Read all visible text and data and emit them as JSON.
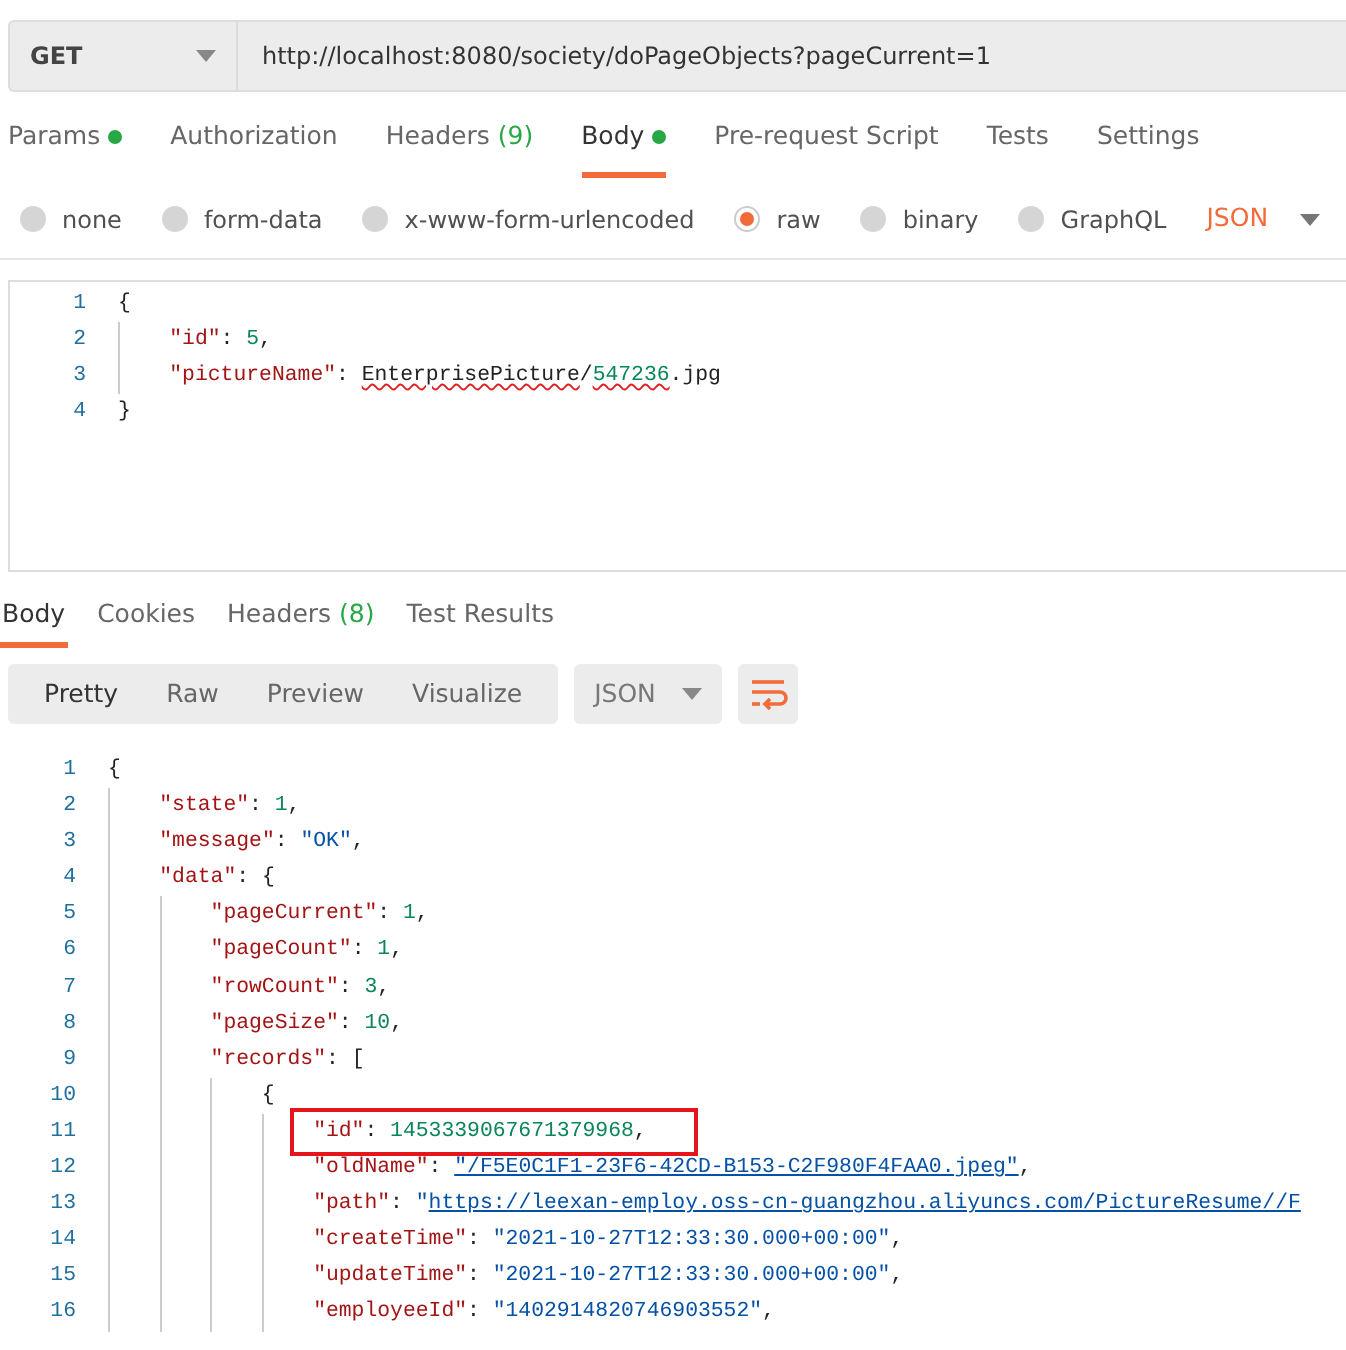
{
  "request": {
    "method": "GET",
    "url": "http://localhost:8080/society/doPageObjects?pageCurrent=1"
  },
  "request_tabs": [
    {
      "label": "Params",
      "dot": true,
      "selected": false
    },
    {
      "label": "Authorization",
      "dot": false,
      "selected": false
    },
    {
      "label": "Headers",
      "count": "(9)",
      "dot": false,
      "selected": false
    },
    {
      "label": "Body",
      "dot": true,
      "selected": true
    },
    {
      "label": "Pre-request Script",
      "dot": false,
      "selected": false
    },
    {
      "label": "Tests",
      "dot": false,
      "selected": false
    },
    {
      "label": "Settings",
      "dot": false,
      "selected": false
    }
  ],
  "body_types": [
    {
      "label": "none",
      "selected": false
    },
    {
      "label": "form-data",
      "selected": false
    },
    {
      "label": "x-www-form-urlencoded",
      "selected": false
    },
    {
      "label": "raw",
      "selected": true
    },
    {
      "label": "binary",
      "selected": false
    },
    {
      "label": "GraphQL",
      "selected": false
    }
  ],
  "body_format": "JSON",
  "request_body": [
    {
      "number": "1",
      "tokens": [
        {
          "kind": "punct",
          "text": "{"
        }
      ],
      "children": [
        {
          "number": "2",
          "tokens": [
            {
              "kind": "key",
              "text": "\"id\""
            },
            {
              "kind": "punct",
              "text": ": "
            },
            {
              "kind": "number",
              "text": "5"
            },
            {
              "kind": "punct",
              "text": ","
            }
          ]
        },
        {
          "number": "3",
          "tokens": [
            {
              "kind": "key",
              "text": "\"pictureName\""
            },
            {
              "kind": "punct",
              "text": ": "
            },
            {
              "kind": "plain-error",
              "text": "EnterprisePicture"
            },
            {
              "kind": "plain",
              "text": "/"
            },
            {
              "kind": "number-error",
              "text": "547236"
            },
            {
              "kind": "plain",
              "text": ".jpg"
            }
          ]
        }
      ]
    },
    {
      "number": "4",
      "tokens": [
        {
          "kind": "punct",
          "text": "}"
        }
      ]
    }
  ],
  "response_tabs": [
    {
      "label": "Body",
      "selected": true
    },
    {
      "label": "Cookies",
      "selected": false
    },
    {
      "label": "Headers",
      "count": "(8)",
      "selected": false
    },
    {
      "label": "Test Results",
      "selected": false
    }
  ],
  "view_modes": [
    {
      "label": "Pretty",
      "selected": true
    },
    {
      "label": "Raw",
      "selected": false
    },
    {
      "label": "Preview",
      "selected": false
    },
    {
      "label": "Visualize",
      "selected": false
    }
  ],
  "response_format": "JSON",
  "response_body": [
    {
      "number": "1",
      "tokens": [
        {
          "kind": "punct",
          "text": "{"
        }
      ],
      "children": [
        {
          "number": "2",
          "tokens": [
            {
              "kind": "key",
              "text": "\"state\""
            },
            {
              "kind": "punct",
              "text": ": "
            },
            {
              "kind": "number",
              "text": "1"
            },
            {
              "kind": "punct",
              "text": ","
            }
          ]
        },
        {
          "number": "3",
          "tokens": [
            {
              "kind": "key",
              "text": "\"message\""
            },
            {
              "kind": "punct",
              "text": ": "
            },
            {
              "kind": "string",
              "text": "\"OK\""
            },
            {
              "kind": "punct",
              "text": ","
            }
          ]
        },
        {
          "number": "4",
          "tokens": [
            {
              "kind": "key",
              "text": "\"data\""
            },
            {
              "kind": "punct",
              "text": ": {"
            }
          ],
          "children": [
            {
              "number": "5",
              "tokens": [
                {
                  "kind": "key",
                  "text": "\"pageCurrent\""
                },
                {
                  "kind": "punct",
                  "text": ": "
                },
                {
                  "kind": "number",
                  "text": "1"
                },
                {
                  "kind": "punct",
                  "text": ","
                }
              ]
            },
            {
              "number": "6",
              "tokens": [
                {
                  "kind": "key",
                  "text": "\"pageCount\""
                },
                {
                  "kind": "punct",
                  "text": ": "
                },
                {
                  "kind": "number",
                  "text": "1"
                },
                {
                  "kind": "punct",
                  "text": ","
                }
              ]
            },
            {
              "number": "7",
              "tokens": [
                {
                  "kind": "key",
                  "text": "\"rowCount\""
                },
                {
                  "kind": "punct",
                  "text": ": "
                },
                {
                  "kind": "number",
                  "text": "3"
                },
                {
                  "kind": "punct",
                  "text": ","
                }
              ]
            },
            {
              "number": "8",
              "tokens": [
                {
                  "kind": "key",
                  "text": "\"pageSize\""
                },
                {
                  "kind": "punct",
                  "text": ": "
                },
                {
                  "kind": "number",
                  "text": "10"
                },
                {
                  "kind": "punct",
                  "text": ","
                }
              ]
            },
            {
              "number": "9",
              "tokens": [
                {
                  "kind": "key",
                  "text": "\"records\""
                },
                {
                  "kind": "punct",
                  "text": ": ["
                }
              ],
              "children": [
                {
                  "number": "10",
                  "tokens": [
                    {
                      "kind": "punct",
                      "text": "{"
                    }
                  ],
                  "children": [
                    {
                      "number": "11",
                      "annotated": true,
                      "tokens": [
                        {
                          "kind": "key",
                          "text": "\"id\""
                        },
                        {
                          "kind": "punct",
                          "text": ": "
                        },
                        {
                          "kind": "number",
                          "text": "1453339067671379968"
                        },
                        {
                          "kind": "punct",
                          "text": ","
                        }
                      ]
                    },
                    {
                      "number": "12",
                      "tokens": [
                        {
                          "kind": "key",
                          "text": "\"oldName\""
                        },
                        {
                          "kind": "punct",
                          "text": ": "
                        },
                        {
                          "kind": "link",
                          "text": "\"/F5E0C1F1-23F6-42CD-B153-C2F980F4FAA0.jpeg\""
                        },
                        {
                          "kind": "punct",
                          "text": ","
                        }
                      ]
                    },
                    {
                      "number": "13",
                      "tokens": [
                        {
                          "kind": "key",
                          "text": "\"path\""
                        },
                        {
                          "kind": "punct",
                          "text": ": "
                        },
                        {
                          "kind": "string",
                          "text": "\""
                        },
                        {
                          "kind": "link",
                          "text": "https://leexan-employ.oss-cn-guangzhou.aliyuncs.com/PictureResume//F"
                        }
                      ]
                    },
                    {
                      "number": "14",
                      "tokens": [
                        {
                          "kind": "key",
                          "text": "\"createTime\""
                        },
                        {
                          "kind": "punct",
                          "text": ": "
                        },
                        {
                          "kind": "string",
                          "text": "\"2021-10-27T12:33:30.000+00:00\""
                        },
                        {
                          "kind": "punct",
                          "text": ","
                        }
                      ]
                    },
                    {
                      "number": "15",
                      "tokens": [
                        {
                          "kind": "key",
                          "text": "\"updateTime\""
                        },
                        {
                          "kind": "punct",
                          "text": ": "
                        },
                        {
                          "kind": "string",
                          "text": "\"2021-10-27T12:33:30.000+00:00\""
                        },
                        {
                          "kind": "punct",
                          "text": ","
                        }
                      ]
                    },
                    {
                      "number": "16",
                      "tokens": [
                        {
                          "kind": "key",
                          "text": "\"employeeId\""
                        },
                        {
                          "kind": "punct",
                          "text": ": "
                        },
                        {
                          "kind": "string",
                          "text": "\"1402914820746903552\""
                        },
                        {
                          "kind": "punct",
                          "text": ","
                        }
                      ]
                    }
                  ]
                }
              ]
            }
          ]
        }
      ]
    }
  ]
}
